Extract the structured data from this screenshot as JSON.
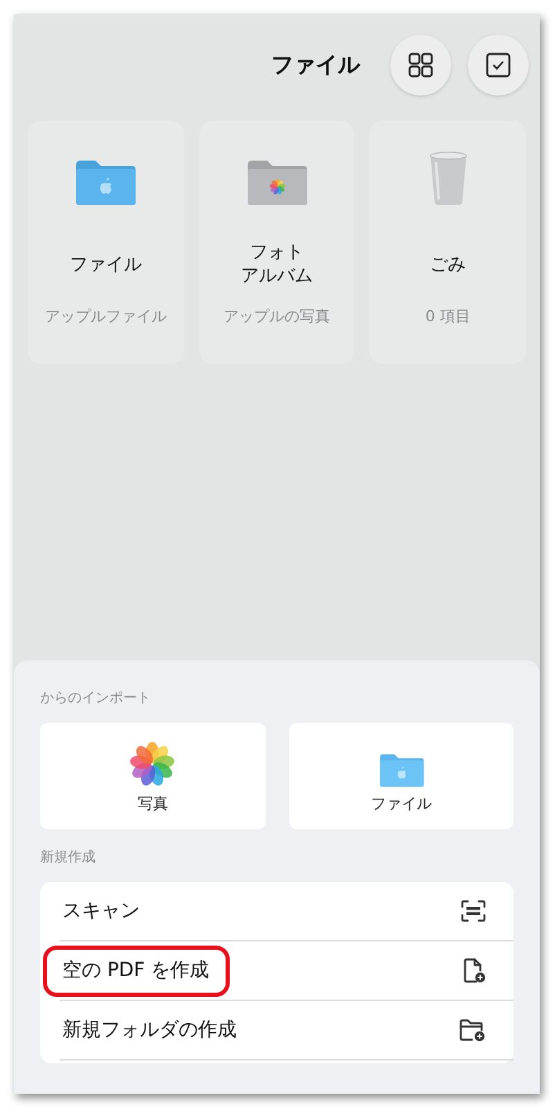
{
  "header": {
    "title": "ファイル"
  },
  "locations": [
    {
      "kind": "files",
      "name_lines": [
        "ファイル"
      ],
      "subtitle": "アップルファイル"
    },
    {
      "kind": "photos",
      "name_lines": [
        "フォト",
        "アルバム"
      ],
      "subtitle": "アップルの写真"
    },
    {
      "kind": "trash",
      "name_lines": [
        "ごみ"
      ],
      "subtitle": "0 項目"
    }
  ],
  "import": {
    "label": "からのインポート",
    "sources": [
      {
        "kind": "photos",
        "label": "写真"
      },
      {
        "kind": "files",
        "label": "ファイル"
      }
    ]
  },
  "create": {
    "label": "新規作成",
    "items": [
      {
        "kind": "scan",
        "label": "スキャン",
        "highlighted": false
      },
      {
        "kind": "pdf",
        "label": "空の PDF を作成",
        "highlighted": true
      },
      {
        "kind": "folder",
        "label": "新規フォルダの作成",
        "highlighted": false
      }
    ]
  }
}
